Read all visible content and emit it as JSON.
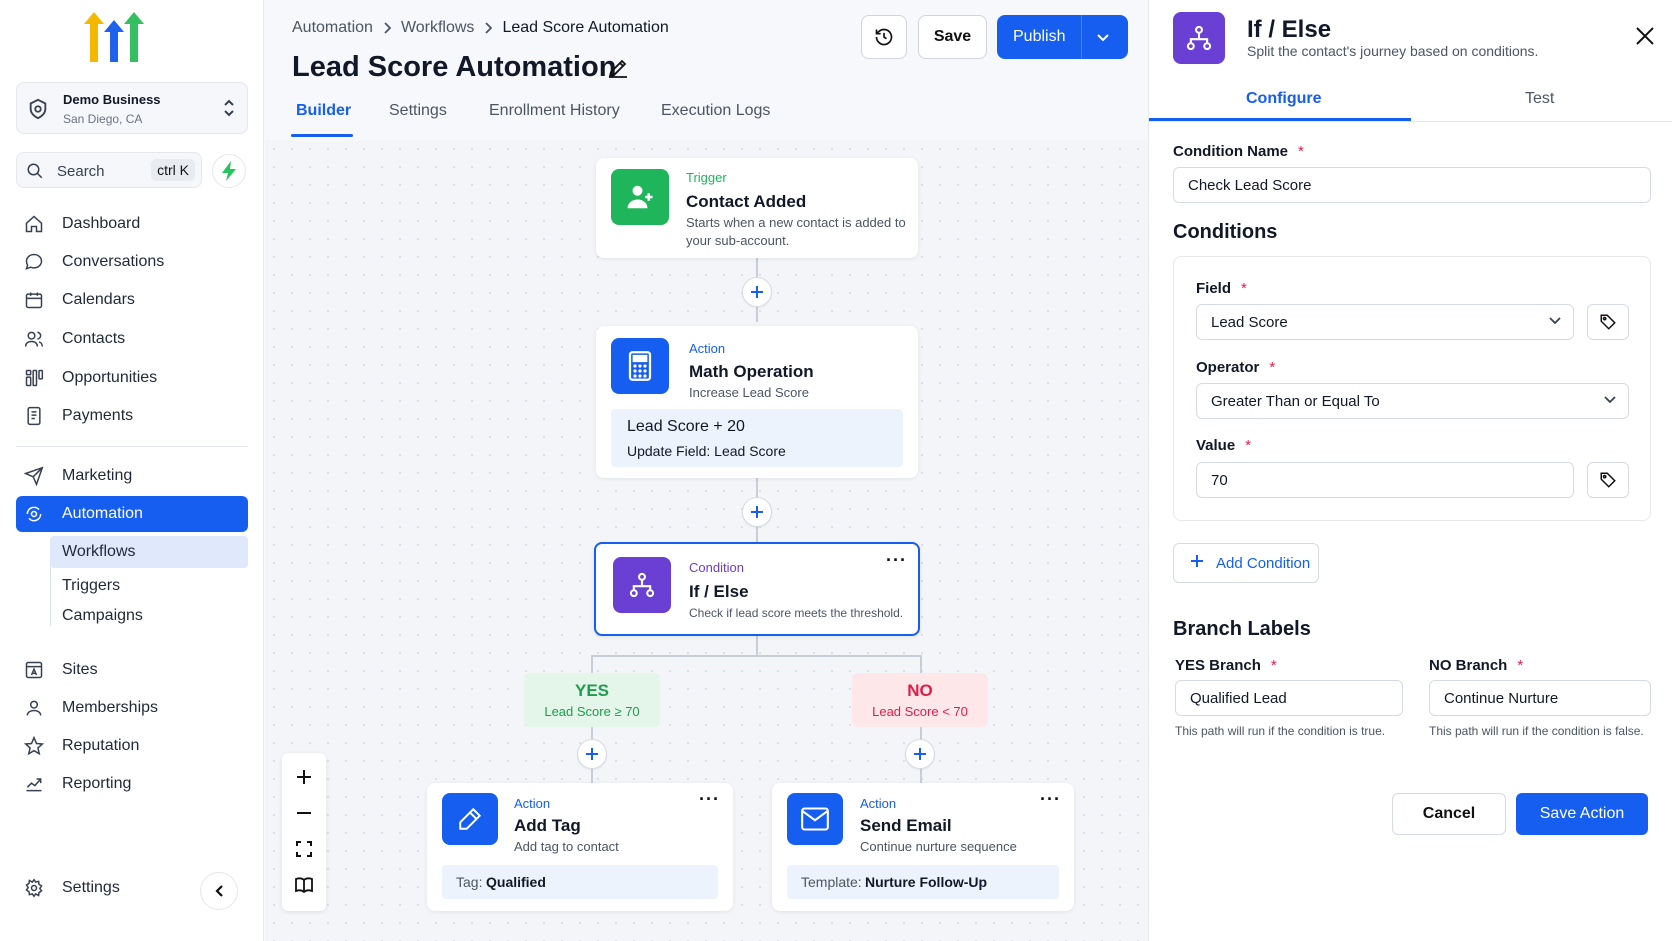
{
  "business": {
    "name": "Demo Business",
    "location": "San Diego, CA"
  },
  "search": {
    "label": "Search",
    "shortcut": "ctrl K"
  },
  "nav": [
    {
      "label": "Dashboard",
      "icon": "home-icon"
    },
    {
      "label": "Conversations",
      "icon": "chat-icon"
    },
    {
      "label": "Calendars",
      "icon": "calendar-icon"
    },
    {
      "label": "Contacts",
      "icon": "contacts-icon"
    },
    {
      "label": "Opportunities",
      "icon": "opportunities-icon"
    },
    {
      "label": "Payments",
      "icon": "payments-icon"
    },
    {
      "label": "Marketing",
      "icon": "send-icon"
    },
    {
      "label": "Automation",
      "icon": "automation-icon"
    },
    {
      "label": "Sites",
      "icon": "sites-icon"
    },
    {
      "label": "Memberships",
      "icon": "user-icon"
    },
    {
      "label": "Reputation",
      "icon": "star-icon"
    },
    {
      "label": "Reporting",
      "icon": "chart-icon"
    },
    {
      "label": "Settings",
      "icon": "gear-icon"
    }
  ],
  "subnav": [
    "Workflows",
    "Triggers",
    "Campaigns"
  ],
  "breadcrumb": [
    "Automation",
    "Workflows",
    "Lead Score Automation"
  ],
  "page_title": "Lead Score Automation",
  "tabs": [
    "Builder",
    "Settings",
    "Enrollment History",
    "Execution Logs"
  ],
  "toolbar": {
    "save": "Save",
    "publish": "Publish"
  },
  "nodes": {
    "trigger": {
      "type": "Trigger",
      "name": "Contact Added",
      "desc": "Starts when a new contact is added to your sub-account."
    },
    "math": {
      "type": "Action",
      "name": "Math Operation",
      "desc": "Increase Lead Score",
      "formula": "Lead Score + 20",
      "update": "Update Field: Lead Score"
    },
    "condition": {
      "type": "Condition",
      "name": "If / Else",
      "desc": "Check if lead score meets the threshold."
    },
    "yes": {
      "label": "YES",
      "rule": "Lead Score ≥ 70"
    },
    "no": {
      "label": "NO",
      "rule": "Lead Score < 70"
    },
    "addtag": {
      "type": "Action",
      "name": "Add Tag",
      "desc": "Add tag to contact",
      "detail_label": "Tag:",
      "detail_value": "Qualified"
    },
    "sendemail": {
      "type": "Action",
      "name": "Send Email",
      "desc": "Continue nurture sequence",
      "detail_label": "Template:",
      "detail_value": "Nurture Follow-Up"
    }
  },
  "panel": {
    "title": "If / Else",
    "subtitle": "Split the contact's journey based on conditions.",
    "tabs": [
      "Configure",
      "Test"
    ],
    "condition_name_label": "Condition Name",
    "condition_name_value": "Check Lead Score",
    "conditions_heading": "Conditions",
    "field_label": "Field",
    "field_value": "Lead Score",
    "operator_label": "Operator",
    "operator_value": "Greater Than or Equal To",
    "value_label": "Value",
    "value_value": "70",
    "add_condition": "Add Condition",
    "branch_heading": "Branch Labels",
    "yes_label": "YES Branch",
    "yes_value": "Qualified Lead",
    "yes_hint": "This path will run if the condition is true.",
    "no_label": "NO Branch",
    "no_value": "Continue Nurture",
    "no_hint": "This path will run if the condition is false.",
    "cancel": "Cancel",
    "save": "Save Action"
  },
  "colors": {
    "primary": "#155eef",
    "trigger": "#1fb55a",
    "condition": "#6a3fd3",
    "yes_bg": "#e3f6e9",
    "yes_text": "#1f9d4d",
    "no_bg": "#fde7e9",
    "no_text": "#e11d48"
  }
}
